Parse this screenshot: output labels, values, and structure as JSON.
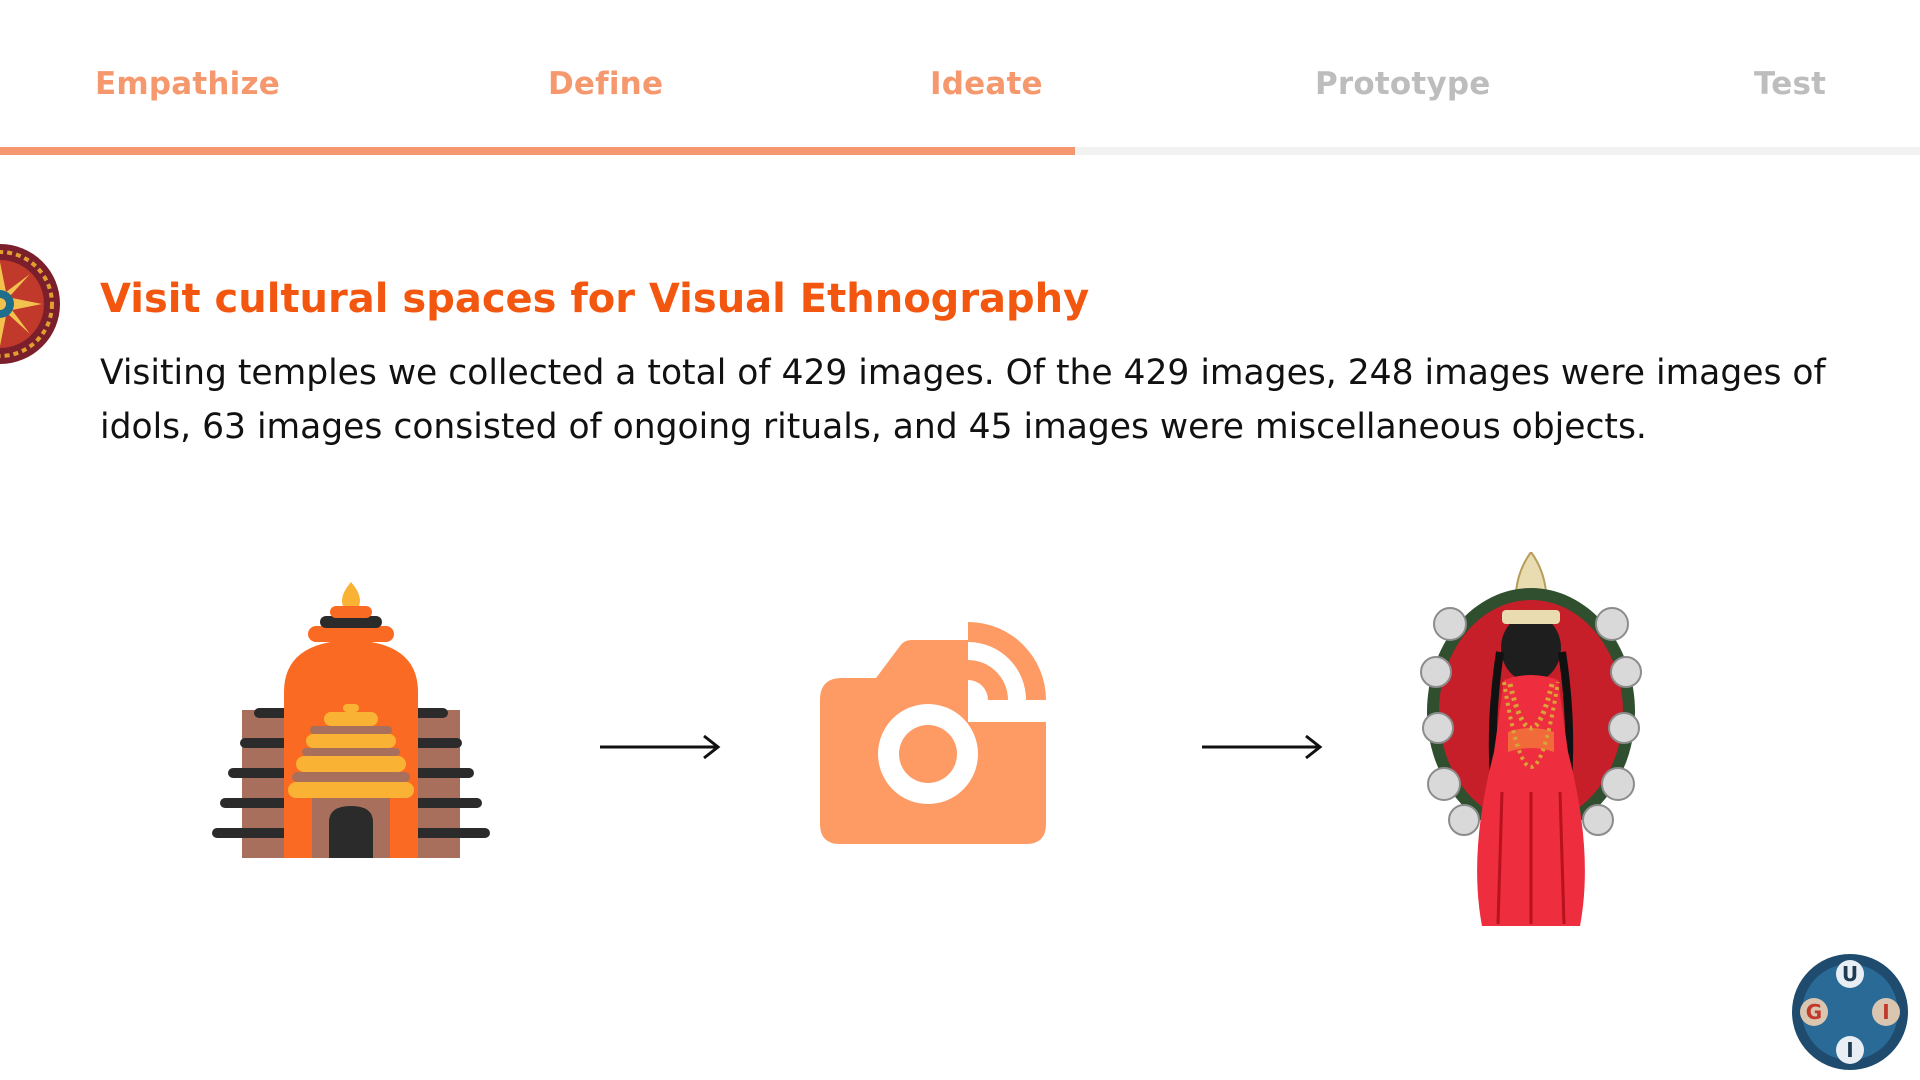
{
  "steps": [
    {
      "label": "Empathize",
      "state": "done"
    },
    {
      "label": "Define",
      "state": "done"
    },
    {
      "label": "Ideate",
      "state": "done"
    },
    {
      "label": "Prototype",
      "state": "todo"
    },
    {
      "label": "Test",
      "state": "todo"
    }
  ],
  "progress": {
    "value": 0.56
  },
  "colors": {
    "accent": "#f6986e",
    "heading": "#f3570f",
    "inactive": "#bdbdbd"
  },
  "content": {
    "heading": "Visit cultural spaces for Visual Ethnography",
    "body": "Visiting temples we collected a total of 429 images. Of the 429 images, 248 images were images of idols, 63 images consisted of ongoing rituals, and 45 images were miscellaneous objects."
  },
  "flow": {
    "icons": [
      "temple-icon",
      "arrow-right-icon",
      "camera-icon",
      "arrow-right-icon",
      "idol-image"
    ]
  },
  "logo": {
    "letters": [
      "U",
      "G",
      "I",
      "I"
    ]
  }
}
